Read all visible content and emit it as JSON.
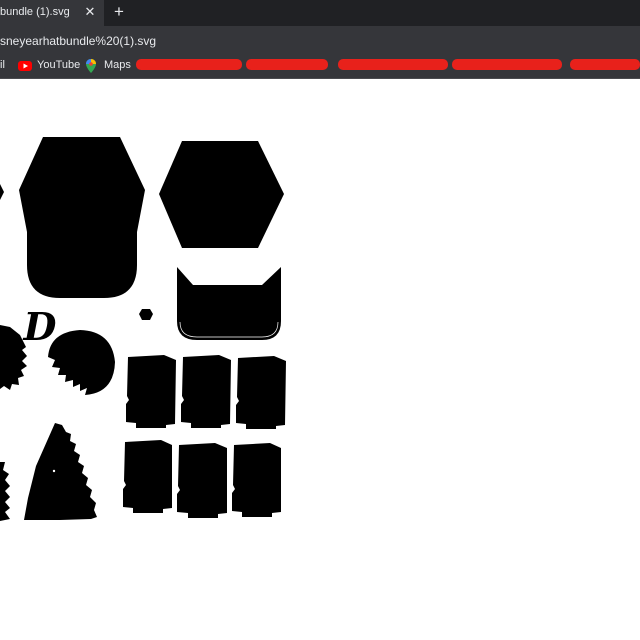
{
  "browser": {
    "tab_title": "bundle (1).svg",
    "close_glyph": "✕",
    "new_tab_glyph": "+",
    "url": "sneyearhatbundle%20(1).svg"
  },
  "bookmarks": {
    "mail_partial": "il",
    "youtube": "YouTube",
    "maps": "Maps",
    "colors": {
      "youtube": "#ff0000",
      "redaction": "#e8211b"
    }
  },
  "canvas": {
    "letter": "D",
    "fill": "#000000"
  }
}
